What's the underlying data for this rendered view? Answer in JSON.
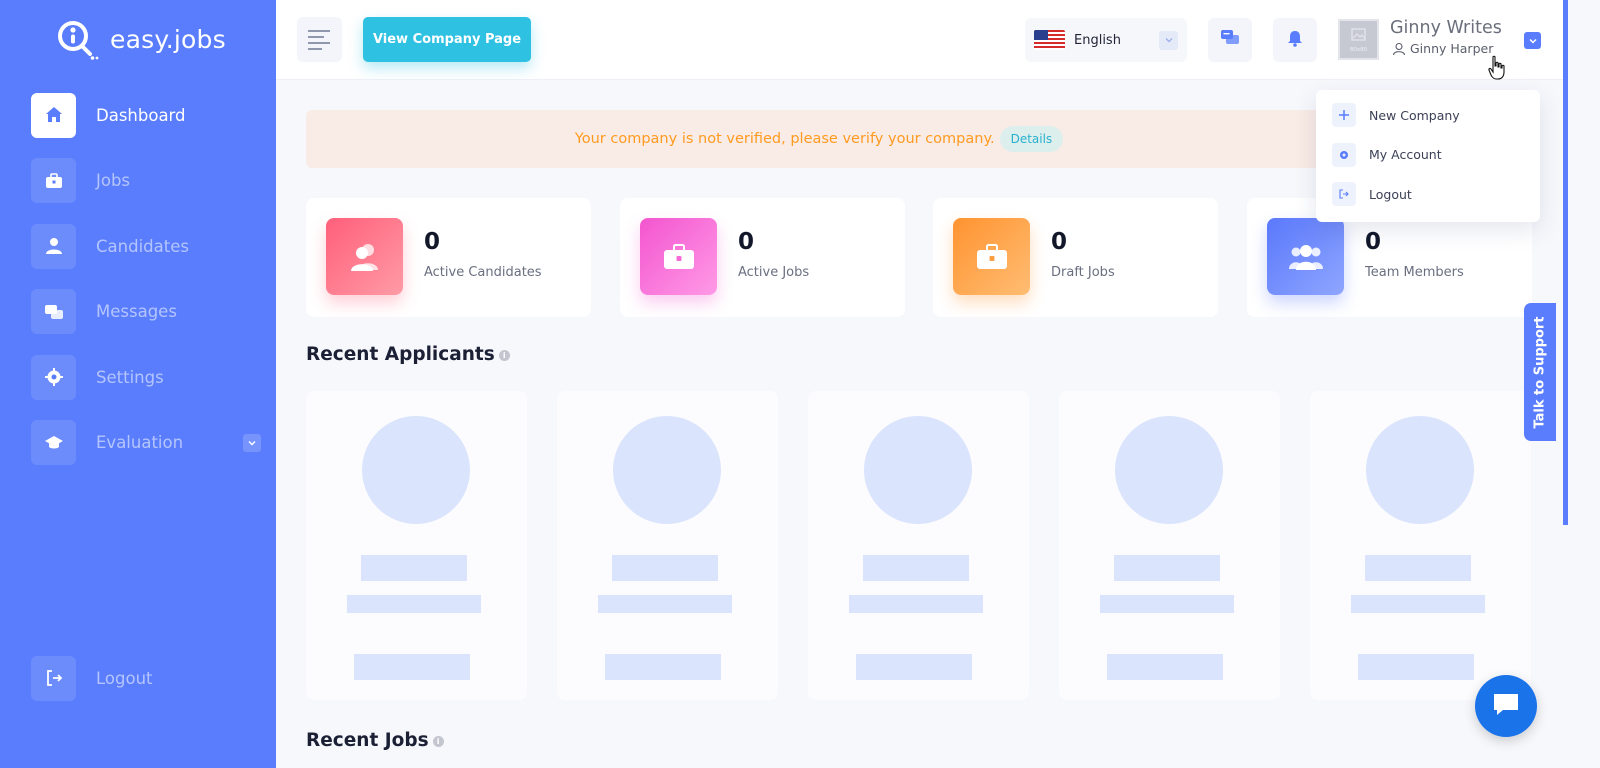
{
  "brand": {
    "name": "easy.jobs",
    "icon": "easyjobs-logo-icon"
  },
  "sidebar": {
    "items": [
      {
        "label": "Dashboard",
        "icon": "home-icon",
        "active": true
      },
      {
        "label": "Jobs",
        "icon": "briefcase-icon",
        "active": false
      },
      {
        "label": "Candidates",
        "icon": "user-icon",
        "active": false
      },
      {
        "label": "Messages",
        "icon": "messages-icon",
        "active": false
      },
      {
        "label": "Settings",
        "icon": "gear-icon",
        "active": false
      },
      {
        "label": "Evaluation",
        "icon": "graduation-cap-icon",
        "active": false
      }
    ],
    "logout_label": "Logout"
  },
  "header": {
    "view_company_label": "View Company Page",
    "language": "English",
    "company_name": "Ginny Writes",
    "user_name": "Ginny Harper",
    "avatar_text": "80x80"
  },
  "user_menu": {
    "items": [
      {
        "label": "New Company",
        "icon": "plus-icon"
      },
      {
        "label": "My Account",
        "icon": "gear-icon"
      },
      {
        "label": "Logout",
        "icon": "logout-icon"
      }
    ]
  },
  "banner": {
    "message": "Your company is not verified, please verify your company.",
    "details_label": "Details"
  },
  "stats": [
    {
      "value": "0",
      "label": "Active Candidates",
      "color": "#ff6b7f"
    },
    {
      "value": "0",
      "label": "Active Jobs",
      "color": "#f86ad6"
    },
    {
      "value": "0",
      "label": "Draft Jobs",
      "color": "#ff9f43"
    },
    {
      "value": "0",
      "label": "Team Members",
      "color": "#6e8dfc"
    }
  ],
  "sections": {
    "recent_applicants": "Recent Applicants",
    "recent_jobs": "Recent Jobs"
  },
  "support_label": "Talk to Support",
  "colors": {
    "primary": "#597dfc",
    "accent": "#2fc1e1",
    "warning_text": "#ff9b21",
    "banner_bg": "#f9ebe5",
    "skeleton": "#dae4fc"
  }
}
